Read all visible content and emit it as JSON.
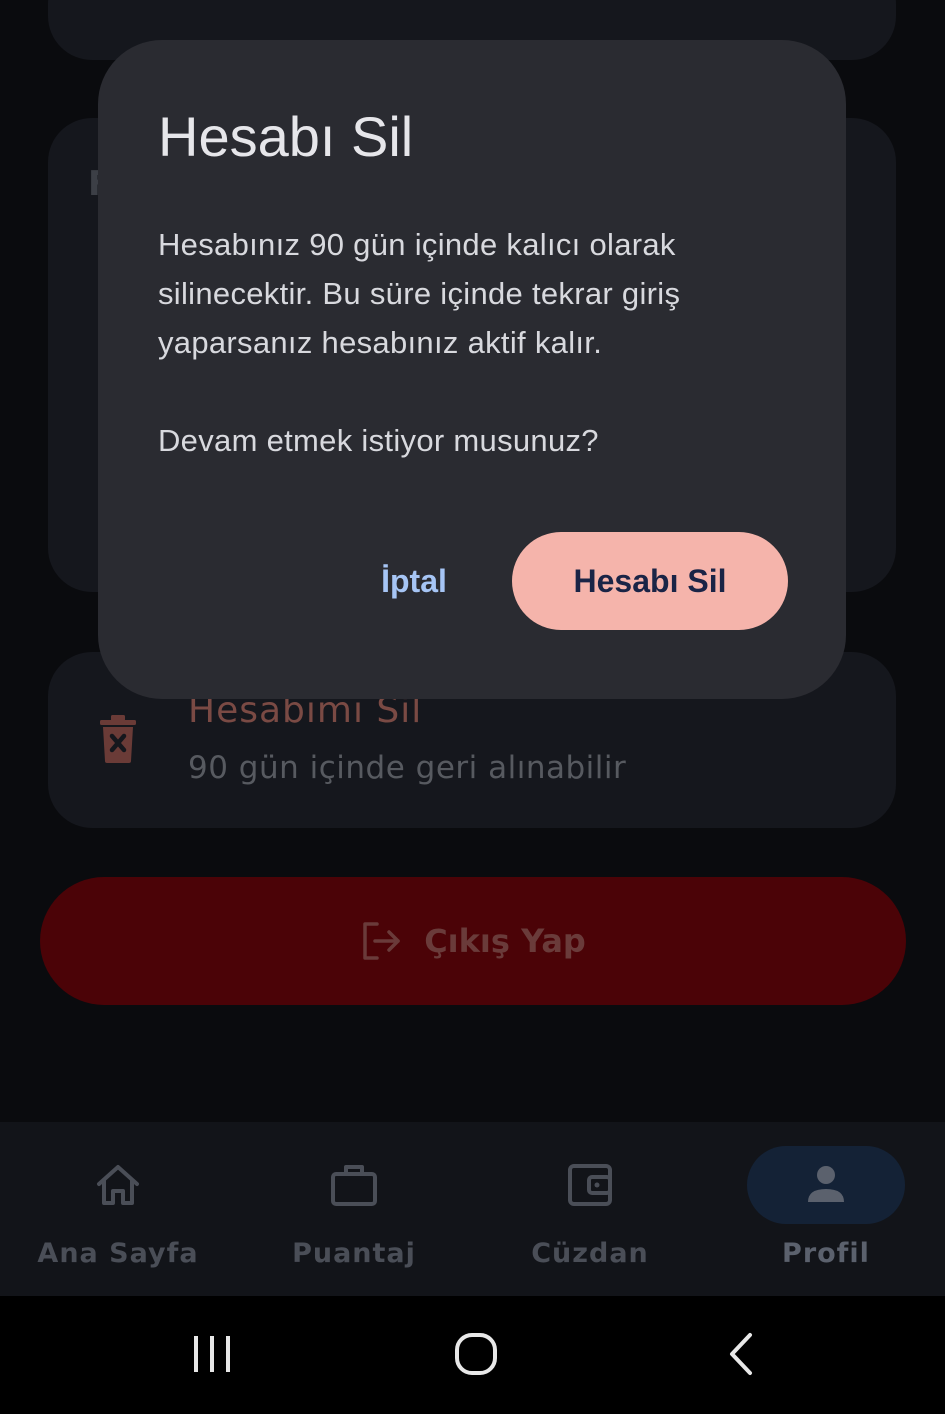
{
  "dialog": {
    "title": "Hesabı Sil",
    "message": "Hesabınız 90 gün içinde kalıcı olarak silinecektir. Bu süre içinde tekrar giriş yaparsanız hesabınız aktif kalır.",
    "question": "Devam etmek istiyor musunuz?",
    "cancel_label": "İptal",
    "confirm_label": "Hesabı Sil"
  },
  "background": {
    "partial_section_letter": "F",
    "delete_item": {
      "title": "Hesabımı Sil",
      "subtitle": "90 gün içinde geri alınabilir",
      "icon": "trash-icon"
    },
    "logout_button": {
      "label": "Çıkış Yap",
      "icon": "logout-icon"
    }
  },
  "bottom_nav": {
    "items": [
      {
        "label": "Ana Sayfa",
        "icon": "home-icon",
        "active": false
      },
      {
        "label": "Puantaj",
        "icon": "briefcase-icon",
        "active": false
      },
      {
        "label": "Cüzdan",
        "icon": "wallet-icon",
        "active": false
      },
      {
        "label": "Profil",
        "icon": "person-icon",
        "active": true
      }
    ]
  },
  "system_bar": {
    "buttons": [
      "recents-icon",
      "home-circle-icon",
      "back-icon"
    ]
  },
  "colors": {
    "background": "#0a0b0e",
    "dialog_surface": "#2a2b31",
    "confirm_button": "#f5b4ab",
    "cancel_text": "#a6c5f5",
    "logout_button": "#4b0307",
    "active_nav_pill": "#142236"
  }
}
